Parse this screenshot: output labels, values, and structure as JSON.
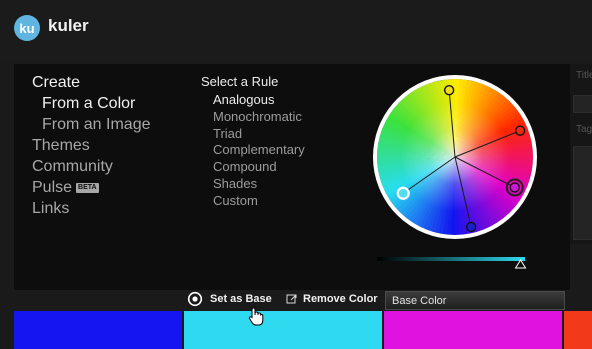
{
  "app": {
    "logo_badge": "ku",
    "name": "kuler"
  },
  "nav": {
    "create": "Create",
    "from_color": "From a Color",
    "from_image": "From an Image",
    "themes": "Themes",
    "community": "Community",
    "pulse": "Pulse",
    "pulse_badge": "BETA",
    "links": "Links"
  },
  "rules": {
    "heading": "Select a Rule",
    "items": [
      "Analogous",
      "Monochromatic",
      "Triad",
      "Complementary",
      "Compound",
      "Shades",
      "Custom"
    ],
    "selected": "Analogous"
  },
  "right_panel": {
    "title_label": "Title",
    "tags_label": "Tags"
  },
  "toolbar": {
    "set_base_label": "Set as Base",
    "remove_label": "Remove Color",
    "base_color_label": "Base Color"
  },
  "swatches": [
    {
      "color": "#1515f2"
    },
    {
      "color": "#2fd9ef"
    },
    {
      "color": "#e012df"
    },
    {
      "color": "#f23a1a"
    }
  ],
  "wheel_markers": [
    {
      "color": "#f2dd18",
      "angle_deg": 355,
      "radius": 0.86
    },
    {
      "color": "#ee2a12",
      "angle_deg": 68,
      "radius": 0.9
    },
    {
      "color": "#cf17d7",
      "angle_deg": 117,
      "radius": 0.86,
      "selected": true
    },
    {
      "color": "#1a1fd0",
      "angle_deg": 167,
      "radius": 0.92
    },
    {
      "color": "#52dcef",
      "angle_deg": 235,
      "radius": 0.81,
      "base": true
    }
  ],
  "brightness_level": 0.97
}
